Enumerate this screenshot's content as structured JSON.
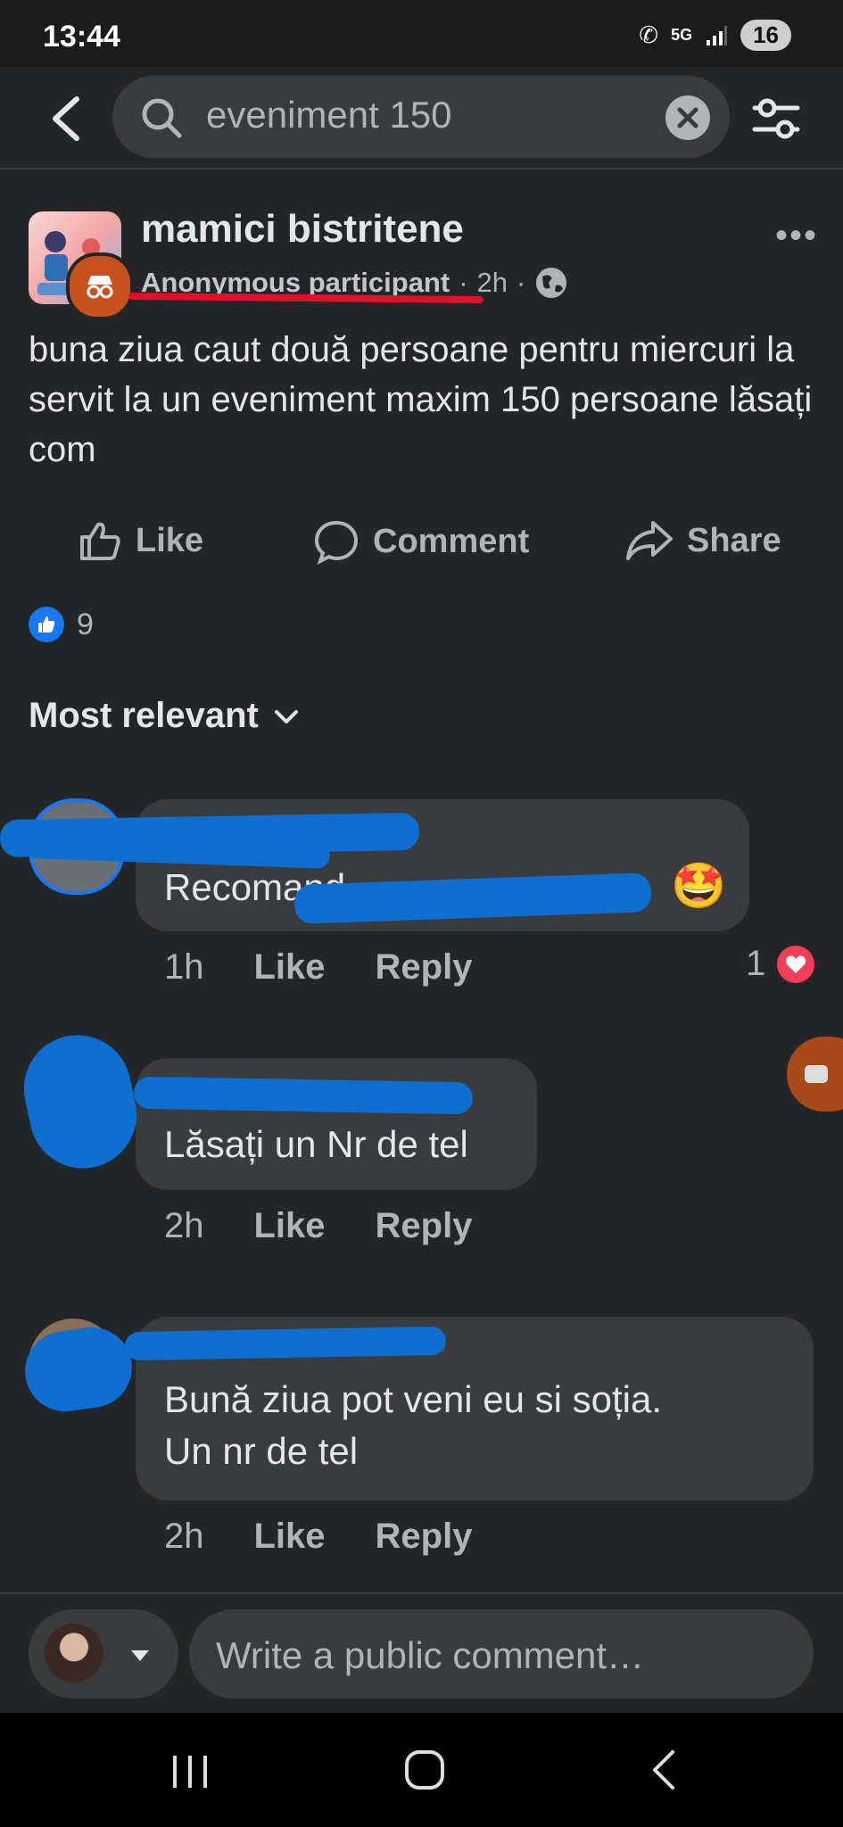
{
  "status_bar": {
    "time": "13:44",
    "network": "5G",
    "battery": "16"
  },
  "search": {
    "query": "eveniment 150"
  },
  "post": {
    "group_name": "mamici bistritene",
    "author": "Anonymous participant",
    "time": "2h",
    "separator": "·",
    "text": "buna ziua caut două persoane pentru miercuri la servit la un eveniment maxim 150 persoane lăsați com",
    "actions": {
      "like": "Like",
      "comment": "Comment",
      "share": "Share"
    },
    "reaction_count": "9"
  },
  "sort_label": "Most relevant",
  "comments": [
    {
      "text": "Recomand",
      "emoji": "🤩",
      "time": "1h",
      "like": "Like",
      "reply": "Reply",
      "reactions": "1"
    },
    {
      "text": "Lăsați un Nr de tel",
      "time": "2h",
      "like": "Like",
      "reply": "Reply"
    },
    {
      "text_line1": "Bună ziua pot veni eu si soția.",
      "text_line2": "Un nr de tel",
      "time": "2h",
      "like": "Like",
      "reply": "Reply"
    }
  ],
  "compose": {
    "placeholder": "Write a public comment…"
  },
  "icons": {
    "back": "back-arrow-icon",
    "search": "search-icon",
    "clear": "clear-icon",
    "filter": "filter-icon",
    "more": "more-options-icon",
    "globe": "globe-icon",
    "like": "thumbs-up-icon",
    "comment": "comment-bubble-icon",
    "share": "share-arrow-icon",
    "heart": "heart-icon"
  },
  "colors": {
    "accent": "#1877f2",
    "background": "#242526",
    "bubble": "#3a3b3c",
    "heart": "#f33e58",
    "underline": "#e0112b"
  }
}
